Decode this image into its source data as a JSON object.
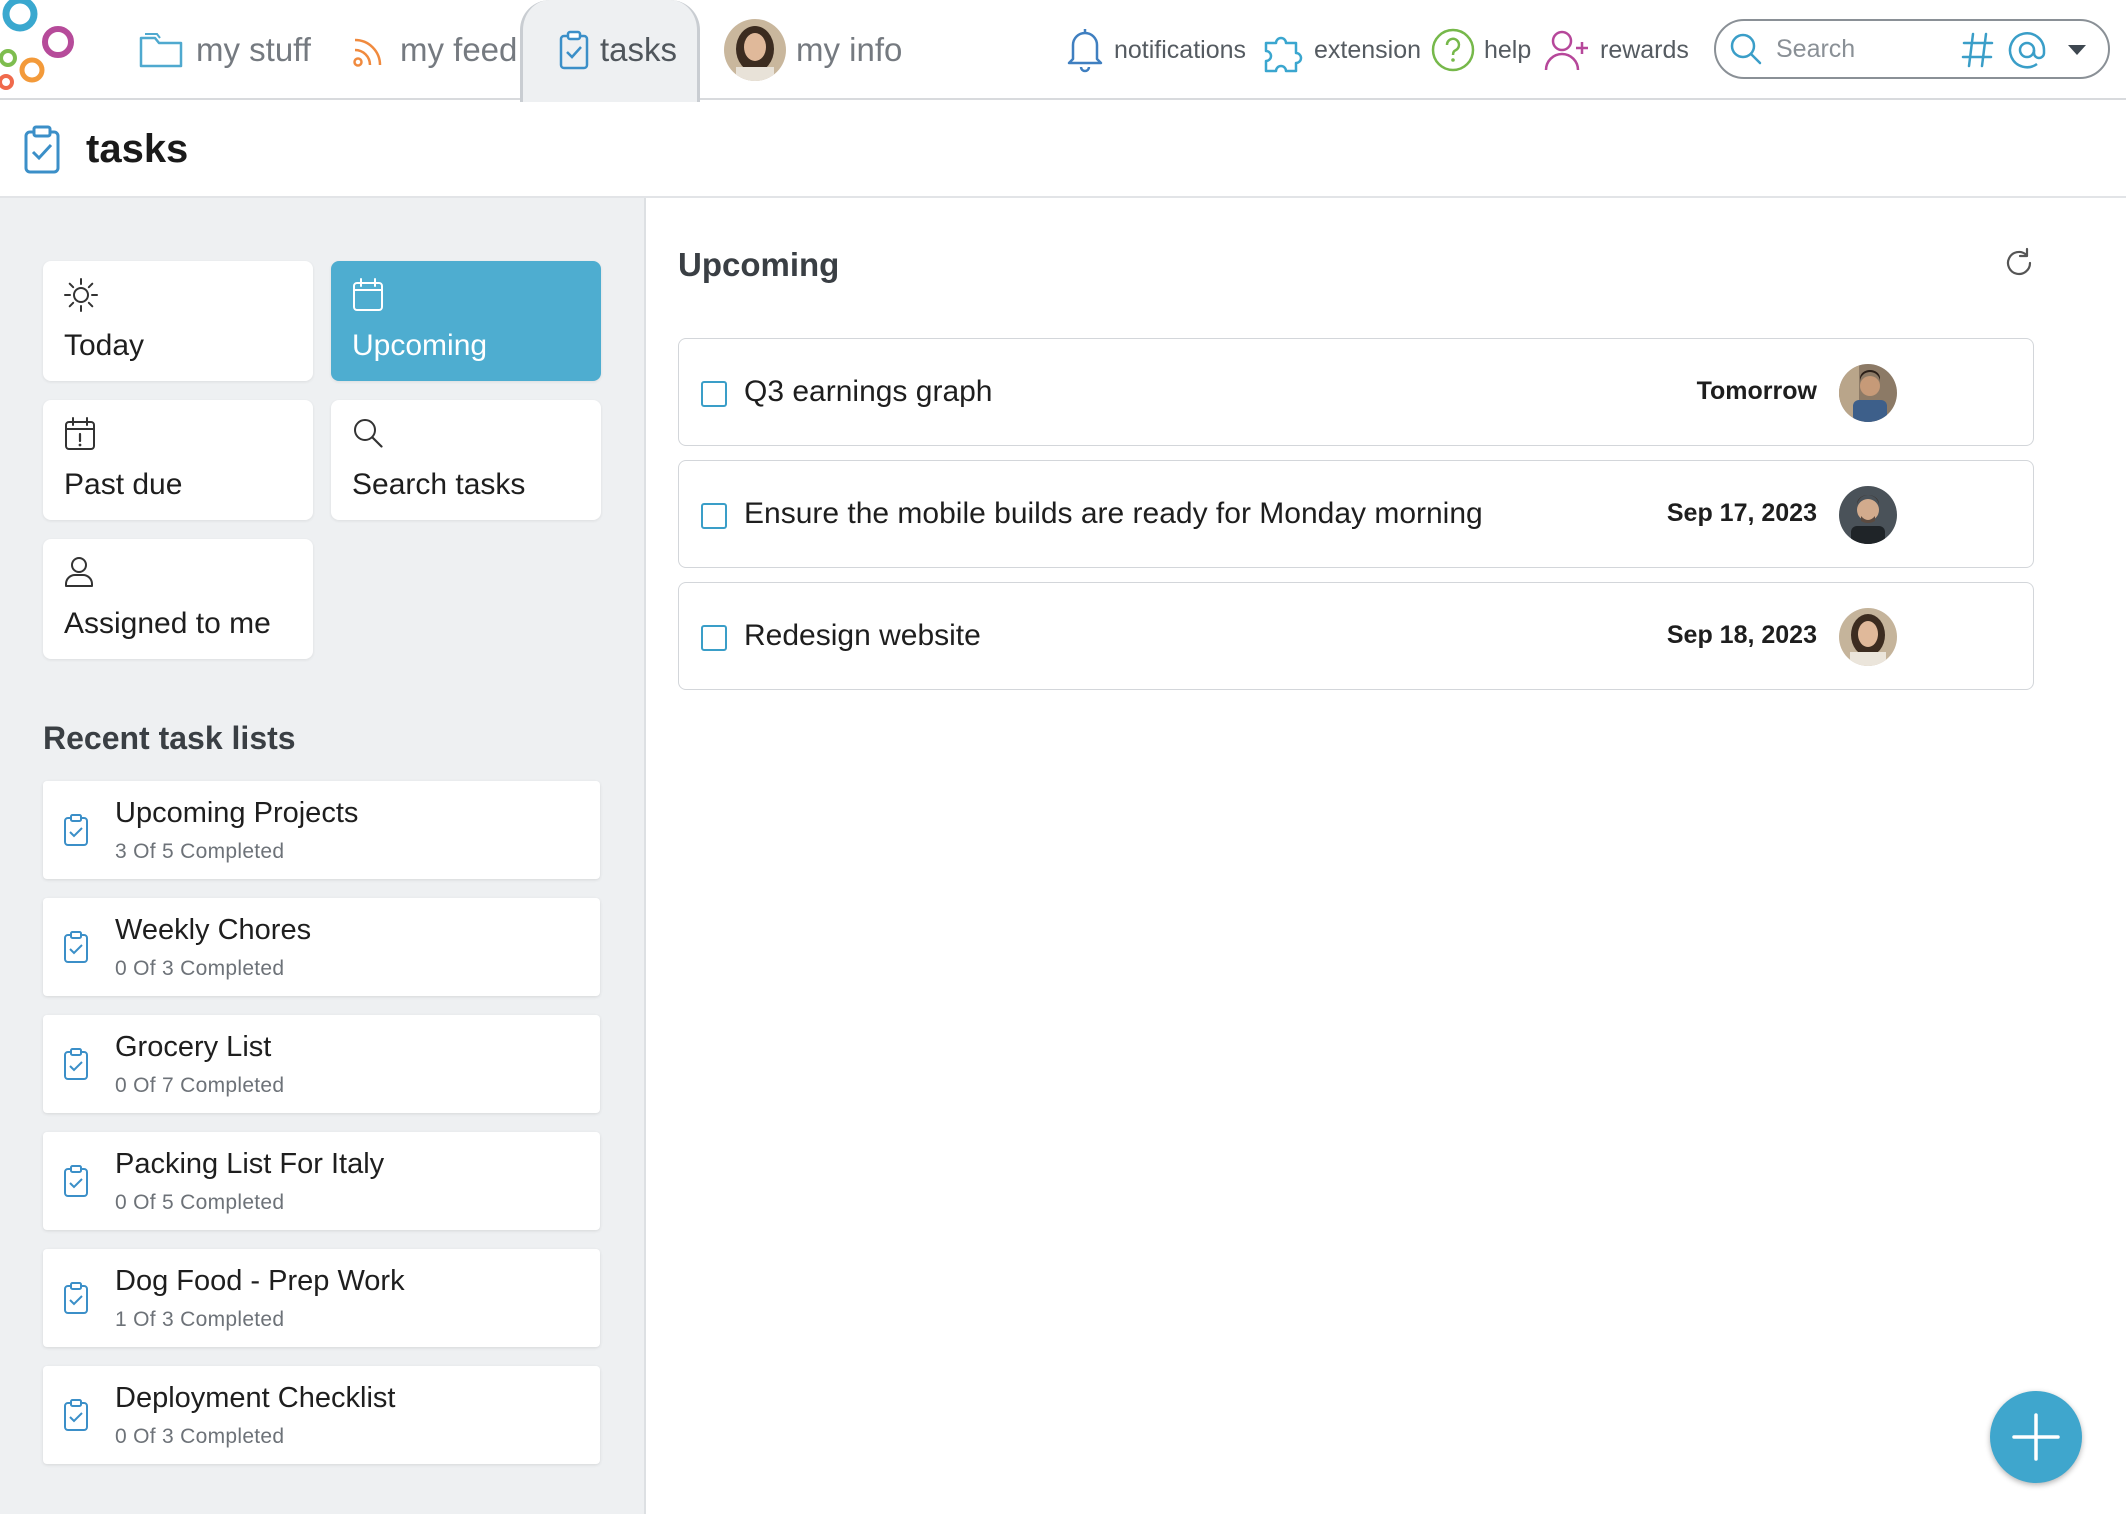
{
  "nav": {
    "my_stuff": "my stuff",
    "my_feed": "my feed",
    "tasks": "tasks",
    "my_info": "my info"
  },
  "utilities": {
    "notifications": "notifications",
    "extension": "extension",
    "help": "help",
    "rewards": "rewards"
  },
  "search": {
    "placeholder": "Search"
  },
  "page": {
    "title": "tasks"
  },
  "filters": [
    {
      "label": "Today",
      "icon": "sun-icon"
    },
    {
      "label": "Upcoming",
      "icon": "calendar-icon",
      "active": true
    },
    {
      "label": "Past due",
      "icon": "calendar-alert-icon"
    },
    {
      "label": "Search tasks",
      "icon": "search-icon"
    },
    {
      "label": "Assigned to me",
      "icon": "user-icon"
    }
  ],
  "recent": {
    "heading": "Recent task lists",
    "lists": [
      {
        "name": "Upcoming Projects",
        "progress": "3 Of 5 Completed"
      },
      {
        "name": "Weekly Chores",
        "progress": "0 Of 3 Completed"
      },
      {
        "name": "Grocery List",
        "progress": "0 Of 7 Completed"
      },
      {
        "name": "Packing List For Italy",
        "progress": "0 Of 5 Completed"
      },
      {
        "name": "Dog Food - Prep Work",
        "progress": "1 Of 3 Completed"
      },
      {
        "name": "Deployment Checklist",
        "progress": "0 Of 3 Completed"
      }
    ]
  },
  "main": {
    "title": "Upcoming",
    "tasks": [
      {
        "name": "Q3 earnings graph",
        "due": "Tomorrow",
        "checked": false
      },
      {
        "name": "Ensure the mobile builds are ready for Monday morning",
        "due": "Sep 17, 2023",
        "checked": false
      },
      {
        "name": "Redesign website",
        "due": "Sep 18, 2023",
        "checked": false
      }
    ]
  },
  "colors": {
    "accent": "#4eadd0",
    "fab": "#3fa6cd",
    "sidebar_bg": "#eef0f2"
  }
}
